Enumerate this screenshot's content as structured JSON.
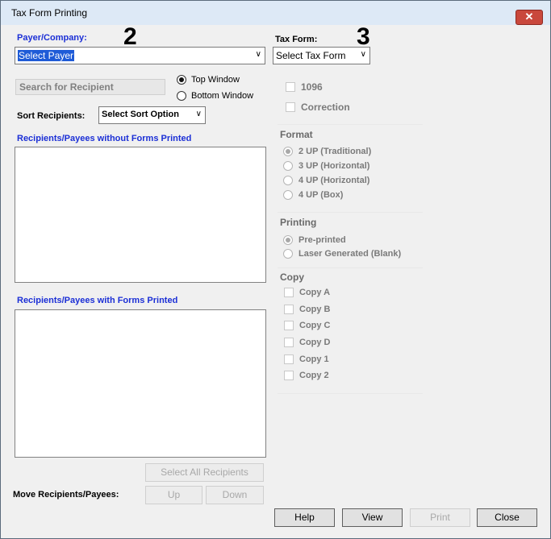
{
  "window": {
    "title": "Tax Form Printing",
    "close_glyph": "✕"
  },
  "annotations": {
    "n2": "2",
    "n3": "3"
  },
  "payer": {
    "label": "Payer/Company:",
    "value": "Select Payer"
  },
  "tax_form": {
    "label": "Tax Form:",
    "value": "Select Tax Form"
  },
  "search": {
    "placeholder": "Search for Recipient"
  },
  "window_choice": {
    "top": "Top Window",
    "bottom": "Bottom Window",
    "selected": "Top Window"
  },
  "sort": {
    "label": "Sort Recipients:",
    "value": "Select Sort Option"
  },
  "lists": {
    "without_label": "Recipients/Payees without Forms Printed",
    "with_label": "Recipients/Payees with Forms Printed"
  },
  "options": {
    "form_1096": "1096",
    "correction": "Correction"
  },
  "format": {
    "title": "Format",
    "options": [
      "2 UP (Traditional)",
      "3 UP (Horizontal)",
      "4 UP (Horizontal)",
      "4 UP (Box)"
    ],
    "selected": "2 UP (Traditional)"
  },
  "printing": {
    "title": "Printing",
    "options": [
      "Pre-printed",
      "Laser Generated (Blank)"
    ],
    "selected": "Pre-printed"
  },
  "copy": {
    "title": "Copy",
    "options": [
      "Copy A",
      "Copy B",
      "Copy C",
      "Copy D",
      "Copy 1",
      "Copy 2"
    ]
  },
  "move": {
    "label": "Move Recipients/Payees:",
    "select_all": "Select All Recipients",
    "up": "Up",
    "down": "Down"
  },
  "buttons": {
    "help": "Help",
    "view": "View",
    "print": "Print",
    "close": "Close"
  }
}
